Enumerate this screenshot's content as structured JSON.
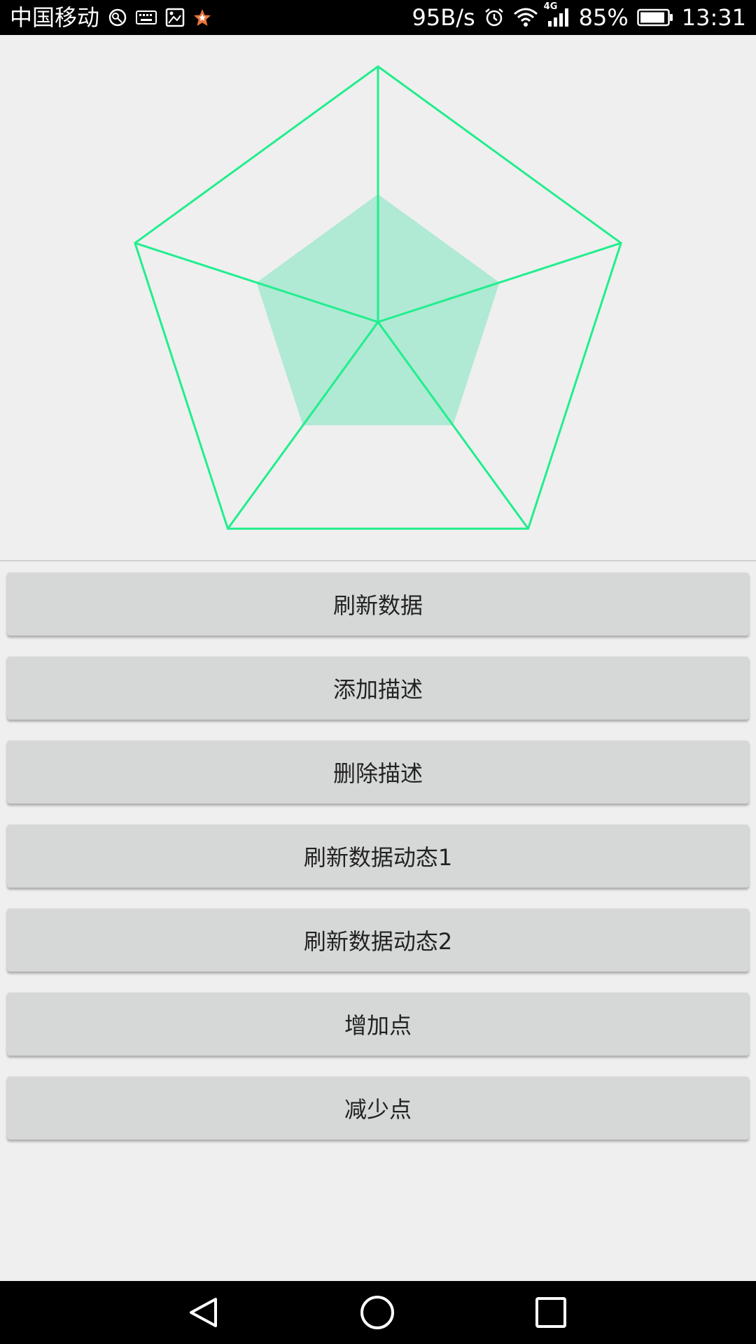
{
  "status_bar": {
    "carrier": "中国移动",
    "net_speed": "95B/s",
    "network_type": "4G",
    "battery": "85%",
    "time": "13:31",
    "left_icons": [
      "vpn-key-icon",
      "keyboard-icon",
      "image-icon",
      "star-app-icon"
    ],
    "right_icons": [
      "alarm-icon",
      "wifi-icon",
      "signal-icon",
      "battery-icon"
    ]
  },
  "chart_data": {
    "type": "radar",
    "axes_count": 5,
    "max_value": 1.0,
    "values": [
      0.5,
      0.5,
      0.5,
      0.5,
      0.5
    ],
    "web_color": "#21ee8d",
    "fill_color": "#b0e9d4",
    "grid": true
  },
  "buttons": [
    {
      "label": "刷新数据"
    },
    {
      "label": "添加描述"
    },
    {
      "label": "删除描述"
    },
    {
      "label": "刷新数据动态1"
    },
    {
      "label": "刷新数据动态2"
    },
    {
      "label": "增加点"
    },
    {
      "label": "减少点"
    }
  ],
  "nav_bar": {
    "icons": [
      "back-icon",
      "home-icon",
      "recents-icon"
    ]
  }
}
